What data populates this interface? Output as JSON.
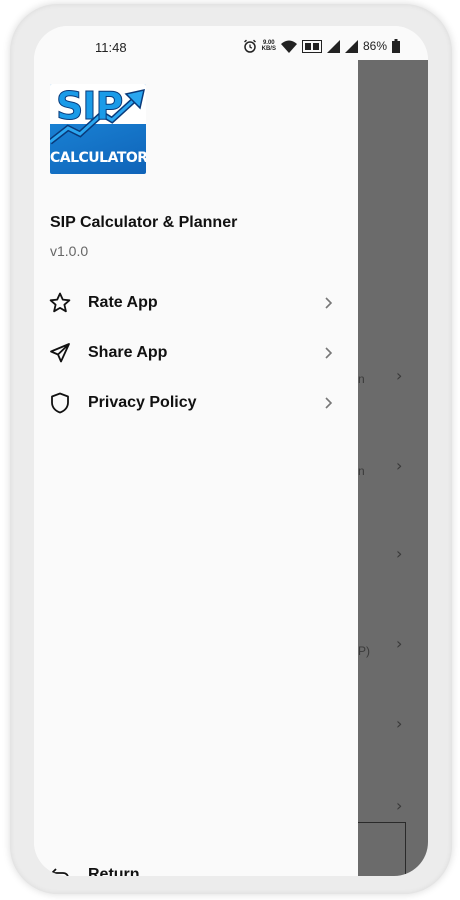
{
  "status_bar": {
    "time": "11:48",
    "speed_value": "9.00",
    "speed_unit": "KB/S",
    "battery": "86%",
    "icons": [
      "alarm-icon",
      "wifi-icon",
      "volte-icon",
      "signal-icon",
      "signal-icon",
      "battery-icon"
    ]
  },
  "drawer": {
    "logo": {
      "top_text": "SIP",
      "bottom_text": "CALCULATOR"
    },
    "app_name": "SIP Calculator & Planner",
    "version": "v1.0.0",
    "items": [
      {
        "label": "Rate App",
        "icon": "star-icon"
      },
      {
        "label": "Share App",
        "icon": "send-icon"
      },
      {
        "label": "Privacy Policy",
        "icon": "shield-icon"
      }
    ],
    "footer": {
      "label": "Return",
      "icon": "return-icon"
    }
  },
  "colors": {
    "drawer_bg": "#fafafa",
    "scrim": "#6b6b6b",
    "logo_blue": "#1a8fe0",
    "text_primary": "#111111",
    "text_secondary": "#666666"
  }
}
